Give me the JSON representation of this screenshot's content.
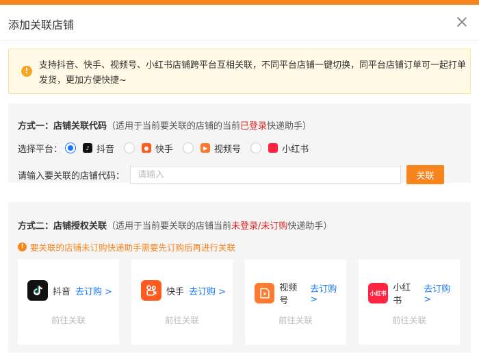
{
  "dialog": {
    "title": "添加关联店铺",
    "notice": "支持抖音、快手、视频号、小红书店铺跨平台互相关联，不同平台店铺一键切换，同平台店铺订单可一起打单发货，更加方便快捷~"
  },
  "method1": {
    "title": "方式一：店铺关联代码",
    "desc_prefix": "（适用于当前要关联的店铺的当前",
    "desc_highlight": "已登录",
    "desc_suffix": "快递助手）",
    "platform_label": "选择平台：",
    "platforms": [
      {
        "name": "抖音",
        "selected": true
      },
      {
        "name": "快手",
        "selected": false
      },
      {
        "name": "视频号",
        "selected": false
      },
      {
        "name": "小红书",
        "selected": false
      }
    ],
    "code_label": "请输入要关联的店铺代码：",
    "code_placeholder": "请输入",
    "code_value": "",
    "button": "关联"
  },
  "method2": {
    "title": "方式二：店铺授权关联",
    "desc_prefix": "（适用于当前要关联的店铺当前",
    "desc_highlight": "未登录/未订购",
    "desc_suffix": "快递助手）",
    "warning": "要关联的店铺未订购快递助手需要先订购后再进行关联",
    "cards": [
      {
        "name": "抖音",
        "subscribe": "去订购 >",
        "goto": "前往关联",
        "icon": "douyin-icon"
      },
      {
        "name": "快手",
        "subscribe": "去订购 >",
        "goto": "前往关联",
        "icon": "kuaishou-icon"
      },
      {
        "name": "视频号",
        "subscribe": "去订购 >",
        "goto": "前往关联",
        "icon": "shipinhao-icon"
      },
      {
        "name": "小红书",
        "subscribe": "去订购 >",
        "goto": "前往关联",
        "icon": "xiaohongshu-icon"
      }
    ],
    "xhs_logo_text": "小红书"
  },
  "colors": {
    "accent": "#f7851d",
    "link": "#1677ff",
    "highlight": "#e02020",
    "notice_bg": "#fff9e6"
  }
}
